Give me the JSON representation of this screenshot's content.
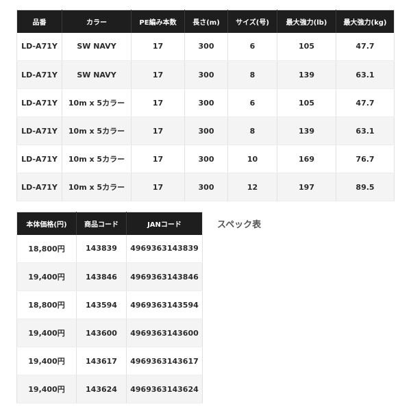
{
  "spec_table": {
    "headers": [
      "品番",
      "カラー",
      "PE編み本数",
      "長さ(m)",
      "サイズ(号)",
      "最大強力(lb)",
      "最大強力(kg)"
    ],
    "rows": [
      [
        "LD-A71Y",
        "SW NAVY",
        "17",
        "300",
        "6",
        "105",
        "47.7"
      ],
      [
        "LD-A71Y",
        "SW NAVY",
        "17",
        "300",
        "8",
        "139",
        "63.1"
      ],
      [
        "LD-A71Y",
        "10m x 5カラー",
        "17",
        "300",
        "6",
        "105",
        "47.7"
      ],
      [
        "LD-A71Y",
        "10m x 5カラー",
        "17",
        "300",
        "8",
        "139",
        "63.1"
      ],
      [
        "LD-A71Y",
        "10m x 5カラー",
        "17",
        "300",
        "10",
        "169",
        "76.7"
      ],
      [
        "LD-A71Y",
        "10m x 5カラー",
        "17",
        "300",
        "12",
        "197",
        "89.5"
      ]
    ]
  },
  "price_table": {
    "headers": [
      "本体価格(円)",
      "商品コード",
      "JANコード"
    ],
    "rows": [
      [
        "18,800円",
        "143839",
        "4969363143839"
      ],
      [
        "19,400円",
        "143846",
        "4969363143846"
      ],
      [
        "18,800円",
        "143594",
        "4969363143594"
      ],
      [
        "19,400円",
        "143600",
        "4969363143600"
      ],
      [
        "19,400円",
        "143617",
        "4969363143617"
      ],
      [
        "19,400円",
        "143624",
        "4969363143624"
      ]
    ]
  },
  "caption": "スペック表",
  "colors": {
    "header_bg": "#1e1e1e",
    "header_text": "#ffffff",
    "row_alt_bg": "#f4f4f4"
  }
}
